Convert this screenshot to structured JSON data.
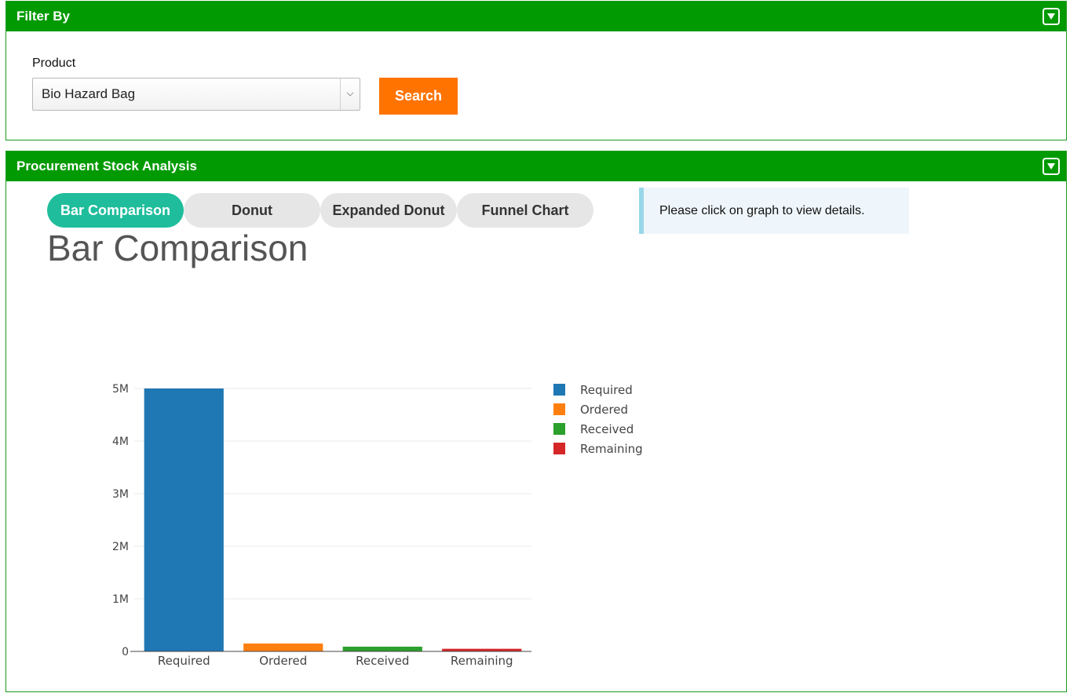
{
  "filter_panel": {
    "title": "Filter By",
    "product_label": "Product",
    "product_value": "Bio Hazard Bag",
    "search_label": "Search"
  },
  "analysis_panel": {
    "title": "Procurement Stock Analysis",
    "tabs": [
      {
        "label": "Bar Comparison",
        "active": true
      },
      {
        "label": "Donut",
        "active": false
      },
      {
        "label": "Expanded Donut",
        "active": false
      },
      {
        "label": "Funnel Chart",
        "active": false
      }
    ],
    "info_message": "Please click on graph to view details.",
    "section_title": "Bar Comparison"
  },
  "chart_data": {
    "type": "bar",
    "categories": [
      "Required",
      "Ordered",
      "Received",
      "Remaining"
    ],
    "values": [
      5000000,
      150000,
      90000,
      50000
    ],
    "colors": [
      "#1f77b4",
      "#ff7f0e",
      "#2ca02c",
      "#d62728"
    ],
    "legend": [
      "Required",
      "Ordered",
      "Received",
      "Remaining"
    ],
    "legend_position": "right",
    "yticks": [
      {
        "value": 0,
        "label": "0"
      },
      {
        "value": 1000000,
        "label": "1M"
      },
      {
        "value": 2000000,
        "label": "2M"
      },
      {
        "value": 3000000,
        "label": "3M"
      },
      {
        "value": 4000000,
        "label": "4M"
      },
      {
        "value": 5000000,
        "label": "5M"
      }
    ],
    "ylim": [
      0,
      5000000
    ],
    "grid": true
  },
  "icons": {
    "collapse": "caret-down-box-icon",
    "select_arrow": "chevron-down-icon"
  }
}
